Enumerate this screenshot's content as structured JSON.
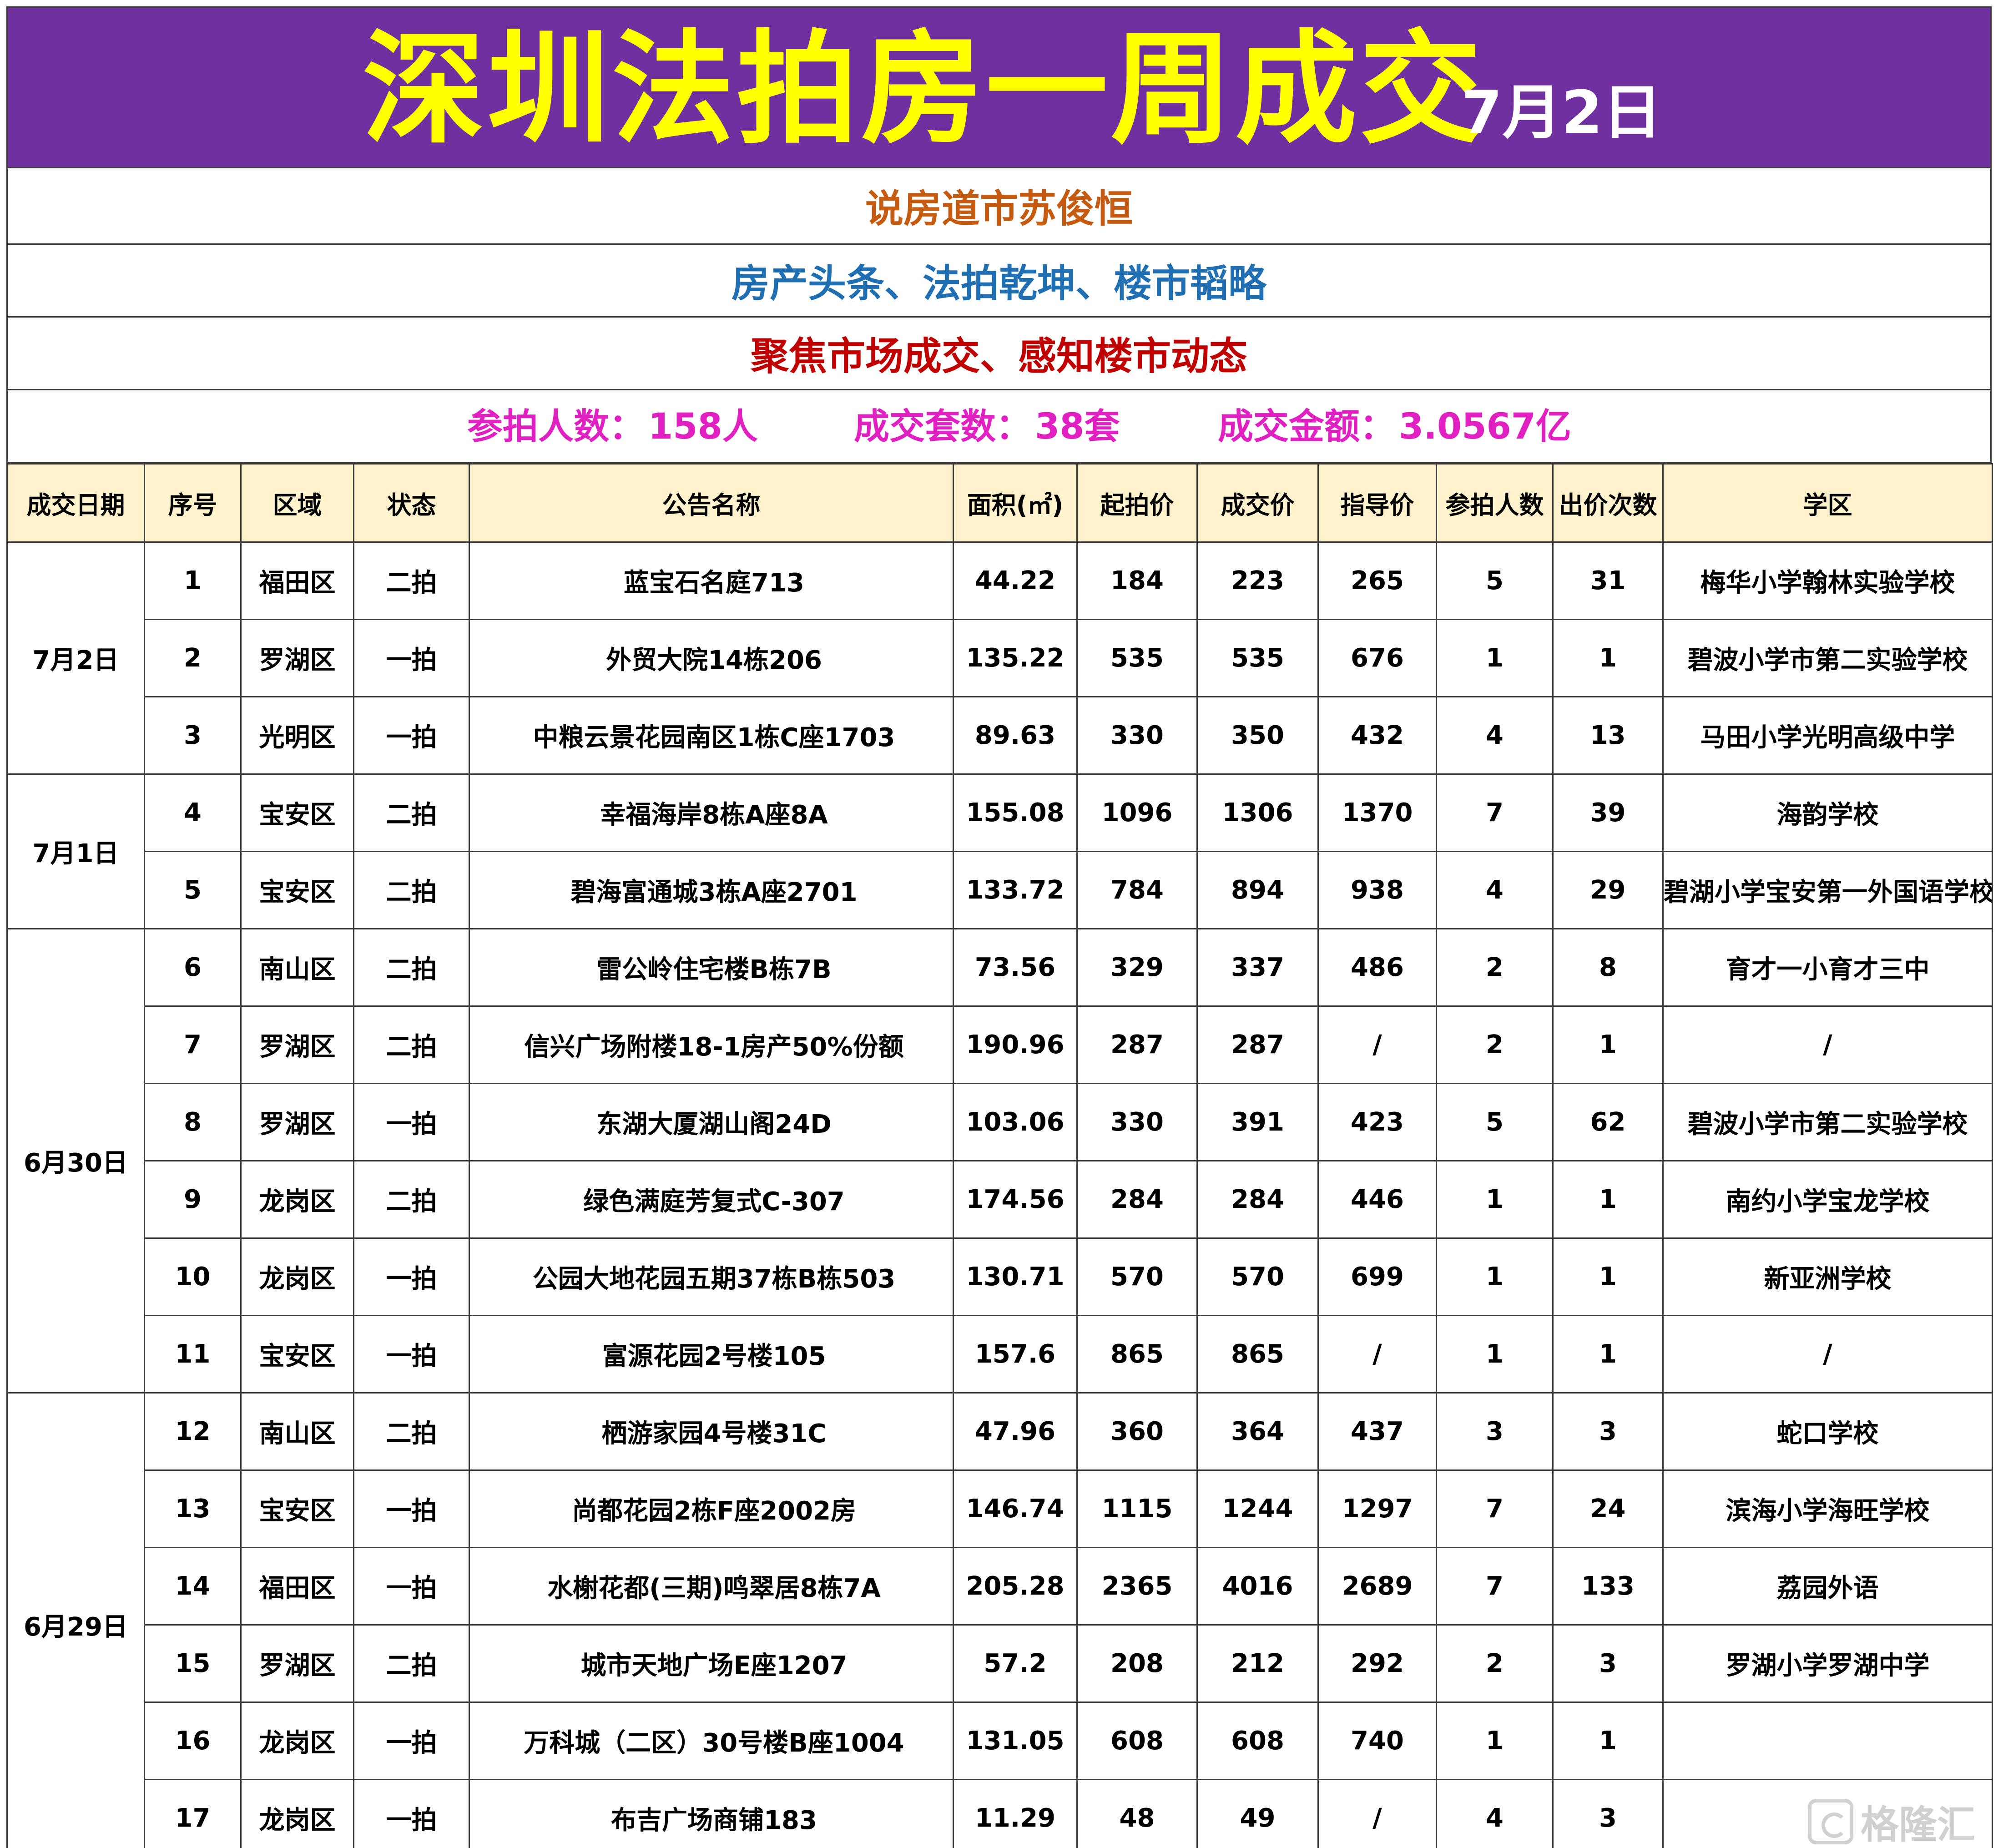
{
  "banner": {
    "title": "深圳法拍房一周成交",
    "date": "7月2日"
  },
  "rows": {
    "author": "说房道市苏俊恒",
    "columns": "房产头条、法拍乾坤、楼市韬略",
    "slogan": "聚焦市场成交、感知楼市动态"
  },
  "summary": {
    "participants_label": "参拍人数：",
    "participants_value": "158人",
    "deals_label": "成交套数：",
    "deals_value": "38套",
    "amount_label": "成交金额：",
    "amount_value": "3.0567亿"
  },
  "table": {
    "headers": {
      "date": "成交日期",
      "no": "序号",
      "district": "区域",
      "status": "状态",
      "name": "公告名称",
      "area": "面积(㎡)",
      "start": "起拍价",
      "deal": "成交价",
      "guide": "指导价",
      "bidders": "参拍人数",
      "bids": "出价次数",
      "school": "学区"
    },
    "groups": [
      {
        "date": "7月2日",
        "rows": [
          {
            "no": "1",
            "district": "福田区",
            "status": "二拍",
            "name": "蓝宝石名庭713",
            "area": "44.22",
            "start": "184",
            "deal": "223",
            "guide": "265",
            "bidders": "5",
            "bids": "31",
            "school": "梅华小学翰林实验学校"
          },
          {
            "no": "2",
            "district": "罗湖区",
            "status": "一拍",
            "name": "外贸大院14栋206",
            "area": "135.22",
            "start": "535",
            "deal": "535",
            "guide": "676",
            "bidders": "1",
            "bids": "1",
            "school": "碧波小学市第二实验学校"
          },
          {
            "no": "3",
            "district": "光明区",
            "status": "一拍",
            "name": "中粮云景花园南区1栋C座1703",
            "area": "89.63",
            "start": "330",
            "deal": "350",
            "guide": "432",
            "bidders": "4",
            "bids": "13",
            "school": "马田小学光明高级中学"
          }
        ]
      },
      {
        "date": "7月1日",
        "rows": [
          {
            "no": "4",
            "district": "宝安区",
            "status": "二拍",
            "name": "幸福海岸8栋A座8A",
            "area": "155.08",
            "start": "1096",
            "deal": "1306",
            "guide": "1370",
            "bidders": "7",
            "bids": "39",
            "school": "海韵学校"
          },
          {
            "no": "5",
            "district": "宝安区",
            "status": "二拍",
            "name": "碧海富通城3栋A座2701",
            "area": "133.72",
            "start": "784",
            "deal": "894",
            "guide": "938",
            "bidders": "4",
            "bids": "29",
            "school": "碧湖小学宝安第一外国语学校"
          }
        ]
      },
      {
        "date": "6月30日",
        "rows": [
          {
            "no": "6",
            "district": "南山区",
            "status": "二拍",
            "name": "雷公岭住宅楼B栋7B",
            "area": "73.56",
            "start": "329",
            "deal": "337",
            "guide": "486",
            "bidders": "2",
            "bids": "8",
            "school": "育才一小育才三中"
          },
          {
            "no": "7",
            "district": "罗湖区",
            "status": "二拍",
            "name": "信兴广场附楼18-1房产50%份额",
            "area": "190.96",
            "start": "287",
            "deal": "287",
            "guide": "/",
            "bidders": "2",
            "bids": "1",
            "school": "/"
          },
          {
            "no": "8",
            "district": "罗湖区",
            "status": "一拍",
            "name": "东湖大厦湖山阁24D",
            "area": "103.06",
            "start": "330",
            "deal": "391",
            "guide": "423",
            "bidders": "5",
            "bids": "62",
            "school": "碧波小学市第二实验学校"
          },
          {
            "no": "9",
            "district": "龙岗区",
            "status": "二拍",
            "name": "绿色满庭芳复式C-307",
            "area": "174.56",
            "start": "284",
            "deal": "284",
            "guide": "446",
            "bidders": "1",
            "bids": "1",
            "school": "南约小学宝龙学校"
          },
          {
            "no": "10",
            "district": "龙岗区",
            "status": "一拍",
            "name": "公园大地花园五期37栋B栋503",
            "area": "130.71",
            "start": "570",
            "deal": "570",
            "guide": "699",
            "bidders": "1",
            "bids": "1",
            "school": "新亚洲学校"
          },
          {
            "no": "11",
            "district": "宝安区",
            "status": "一拍",
            "name": "富源花园2号楼105",
            "area": "157.6",
            "start": "865",
            "deal": "865",
            "guide": "/",
            "bidders": "1",
            "bids": "1",
            "school": "/"
          }
        ]
      },
      {
        "date": "6月29日",
        "rows": [
          {
            "no": "12",
            "district": "南山区",
            "status": "二拍",
            "name": "栖游家园4号楼31C",
            "area": "47.96",
            "start": "360",
            "deal": "364",
            "guide": "437",
            "bidders": "3",
            "bids": "3",
            "school": "蛇口学校"
          },
          {
            "no": "13",
            "district": "宝安区",
            "status": "一拍",
            "name": "尚都花园2栋F座2002房",
            "area": "146.74",
            "start": "1115",
            "deal": "1244",
            "guide": "1297",
            "bidders": "7",
            "bids": "24",
            "school": "滨海小学海旺学校"
          },
          {
            "no": "14",
            "district": "福田区",
            "status": "一拍",
            "name": "水榭花都(三期)鸣翠居8栋7A",
            "area": "205.28",
            "start": "2365",
            "deal": "4016",
            "guide": "2689",
            "bidders": "7",
            "bids": "133",
            "school": "荔园外语"
          },
          {
            "no": "15",
            "district": "罗湖区",
            "status": "二拍",
            "name": "城市天地广场E座1207",
            "area": "57.2",
            "start": "208",
            "deal": "212",
            "guide": "292",
            "bidders": "2",
            "bids": "3",
            "school": "罗湖小学罗湖中学"
          },
          {
            "no": "16",
            "district": "龙岗区",
            "status": "一拍",
            "name": "万科城（二区）30号楼B座1004",
            "area": "131.05",
            "start": "608",
            "deal": "608",
            "guide": "740",
            "bidders": "1",
            "bids": "1",
            "school": ""
          },
          {
            "no": "17",
            "district": "龙岗区",
            "status": "一拍",
            "name": "布吉广场商铺183",
            "area": "11.29",
            "start": "48",
            "deal": "49",
            "guide": "/",
            "bidders": "4",
            "bids": "3",
            "school": ""
          }
        ]
      }
    ]
  },
  "watermark": {
    "text": "格隆汇",
    "icon": "gelonghui-logo-icon"
  }
}
